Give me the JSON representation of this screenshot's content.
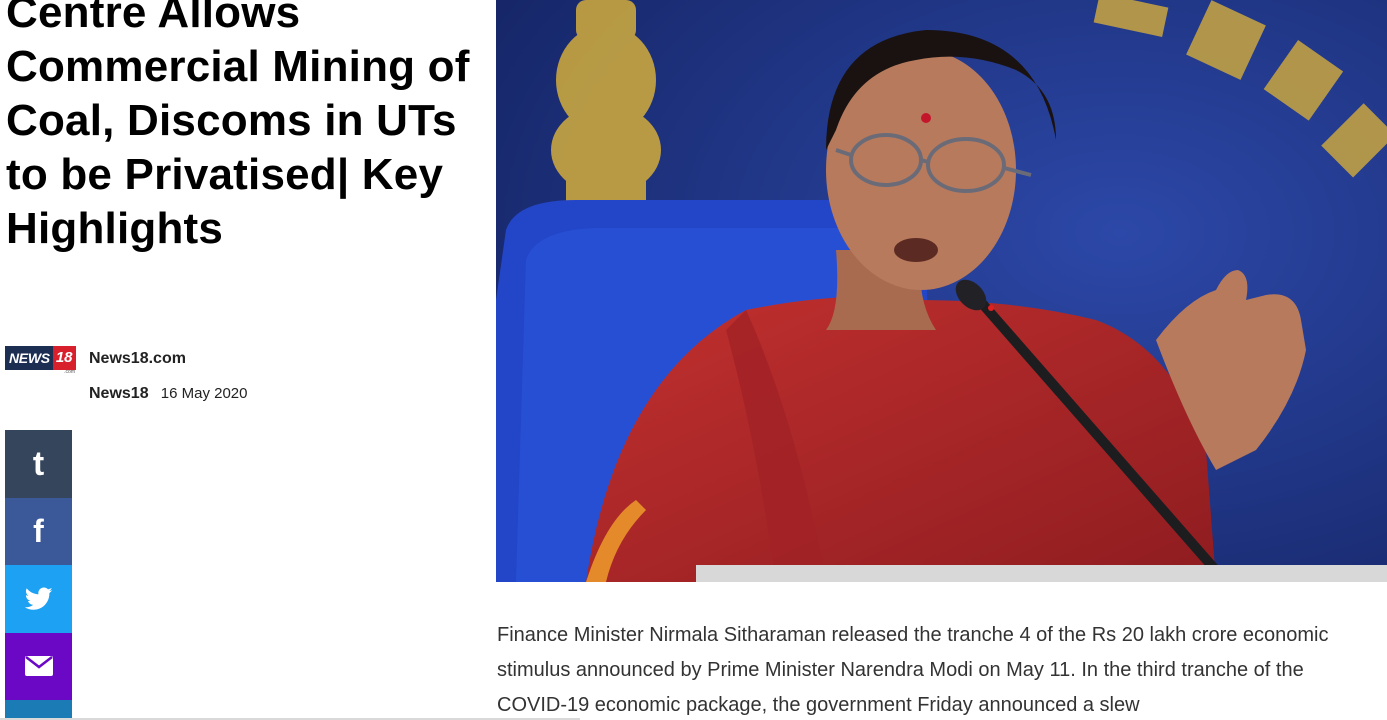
{
  "article": {
    "headline": "Centre Allows Commercial Mining of Coal, Discoms in UTs to be Privatised| Key Highlights",
    "source": {
      "logo_text": "NEWS",
      "logo_number": "18",
      "logo_sub": ".com",
      "name": "News18.com"
    },
    "author": "News18",
    "date": "16 May 2020",
    "body": "Finance Minister Nirmala Sitharaman released the tranche 4 of the Rs 20 lakh crore economic stimulus announced by Prime Minister Narendra Modi on May 11. In the third tranche of the COVID-19 economic package, the government Friday announced a slew"
  },
  "share": {
    "buttons": [
      {
        "name": "tumblr",
        "glyph": "t",
        "color": "#35465c"
      },
      {
        "name": "facebook",
        "glyph": "f",
        "color": "#3b5998"
      },
      {
        "name": "twitter",
        "glyph": "twitter-bird",
        "color": "#1da1f2"
      },
      {
        "name": "email",
        "glyph": "envelope",
        "color": "#6b08c6"
      }
    ]
  },
  "hero_image": {
    "depicts": "photo",
    "colors": {
      "background": "#22378f",
      "saree": "#b3262a",
      "chair": "#2346c8"
    }
  }
}
